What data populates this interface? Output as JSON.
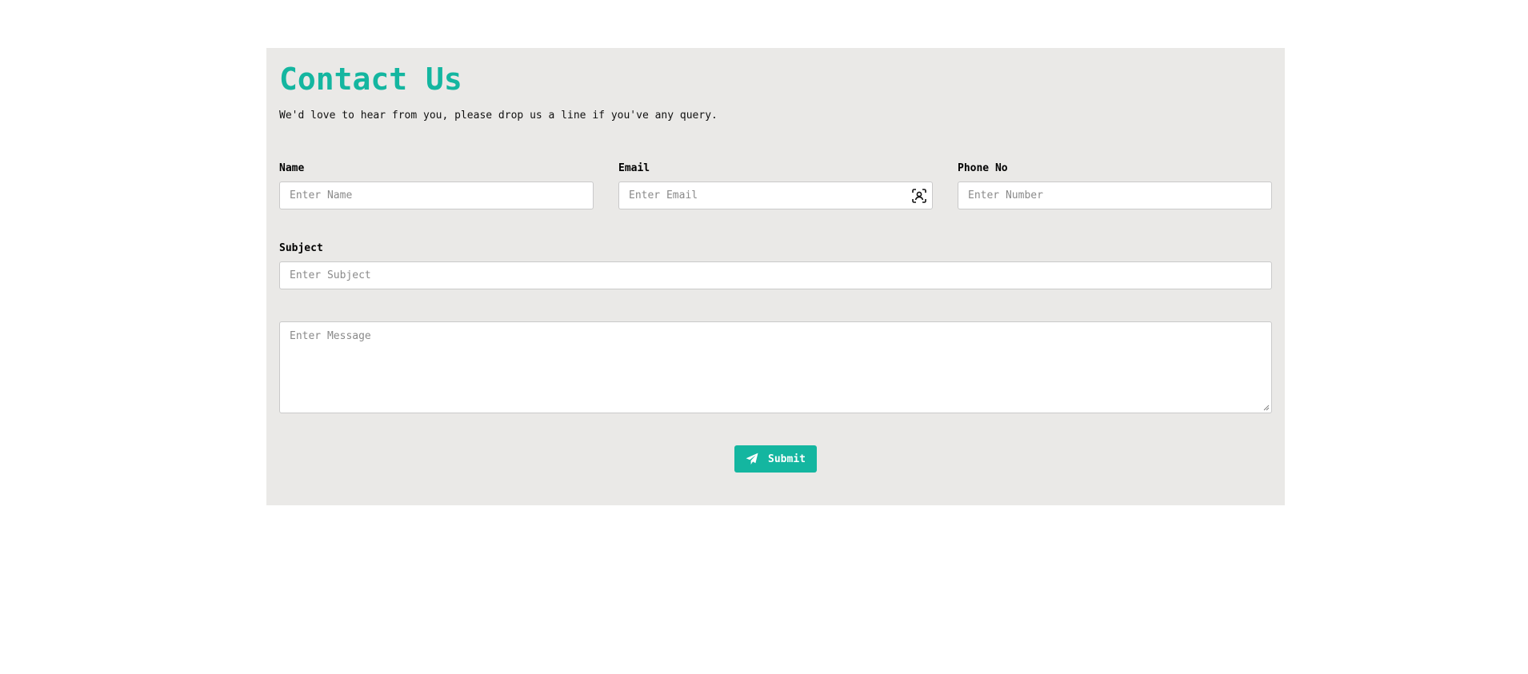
{
  "header": {
    "title": "Contact Us",
    "subtitle": "We'd love to hear from you, please drop us a line if you've any query."
  },
  "form": {
    "name": {
      "label": "Name",
      "placeholder": "Enter Name"
    },
    "email": {
      "label": "Email",
      "placeholder": "Enter Email"
    },
    "phone": {
      "label": "Phone No",
      "placeholder": "Enter Number"
    },
    "subject": {
      "label": "Subject",
      "placeholder": "Enter Subject"
    },
    "message": {
      "placeholder": "Enter Message"
    },
    "submit_label": "Submit"
  },
  "colors": {
    "accent": "#14b6a0",
    "panel_background": "#eae9e7"
  },
  "icons": {
    "email_field": "contact-card-icon",
    "submit": "paper-plane-icon"
  }
}
